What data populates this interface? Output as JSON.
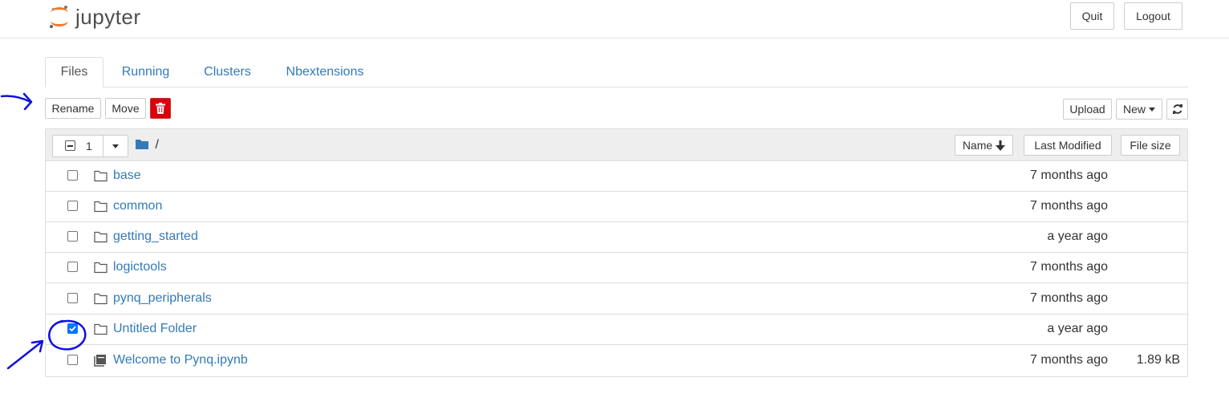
{
  "header": {
    "logo_text": "jupyter",
    "quit_label": "Quit",
    "logout_label": "Logout"
  },
  "tabs": [
    {
      "label": "Files",
      "active": true
    },
    {
      "label": "Running",
      "active": false
    },
    {
      "label": "Clusters",
      "active": false
    },
    {
      "label": "Nbextensions",
      "active": false
    }
  ],
  "toolbar": {
    "rename_label": "Rename",
    "move_label": "Move",
    "upload_label": "Upload",
    "new_label": "New"
  },
  "list_header": {
    "selected_count": "1",
    "path": "/",
    "sort_name_label": "Name",
    "last_modified_label": "Last Modified",
    "file_size_label": "File size"
  },
  "items": [
    {
      "name": "base",
      "type": "folder",
      "modified": "7 months ago",
      "size": "",
      "checked": false
    },
    {
      "name": "common",
      "type": "folder",
      "modified": "7 months ago",
      "size": "",
      "checked": false
    },
    {
      "name": "getting_started",
      "type": "folder",
      "modified": "a year ago",
      "size": "",
      "checked": false
    },
    {
      "name": "logictools",
      "type": "folder",
      "modified": "7 months ago",
      "size": "",
      "checked": false
    },
    {
      "name": "pynq_peripherals",
      "type": "folder",
      "modified": "7 months ago",
      "size": "",
      "checked": false
    },
    {
      "name": "Untitled Folder",
      "type": "folder",
      "modified": "a year ago",
      "size": "",
      "checked": true
    },
    {
      "name": "Welcome to Pynq.ipynb",
      "type": "notebook",
      "modified": "7 months ago",
      "size": "1.89 kB",
      "checked": false
    }
  ],
  "colors": {
    "link": "#337ab7",
    "danger": "#d9000b",
    "annotation": "#1010e0",
    "logo_orange": "#f37726"
  }
}
